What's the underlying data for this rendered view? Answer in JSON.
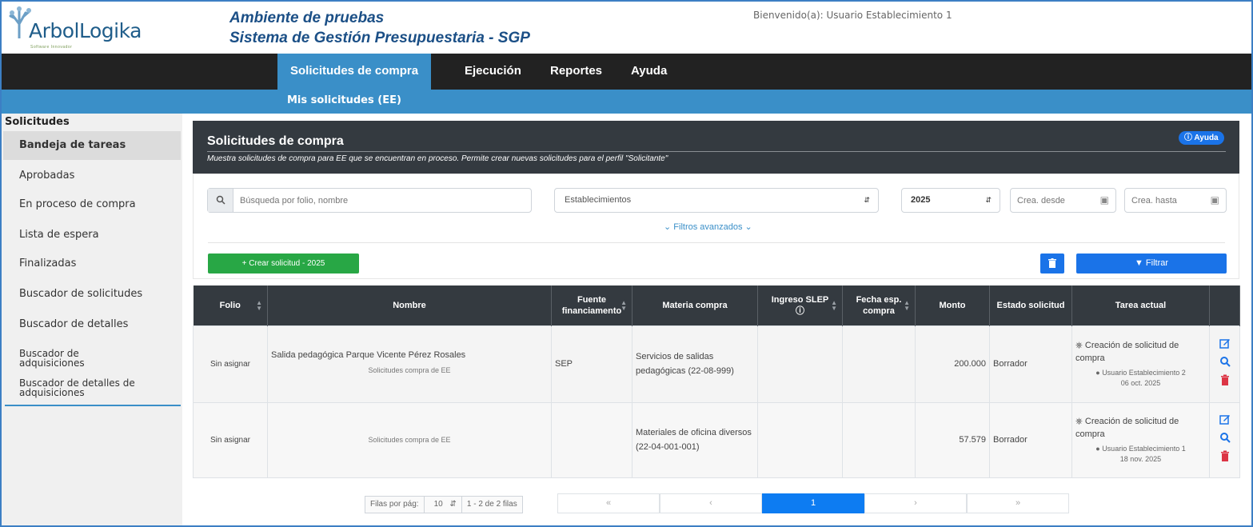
{
  "brand": {
    "name_a": "Arbol",
    "name_b": "Logika",
    "tagline": "Software Innovador"
  },
  "header": {
    "env": "Ambiente de pruebas",
    "system": "Sistema de Gestión Presupuestaria - SGP",
    "welcome": "Bienvenido(a): Usuario Establecimiento 1"
  },
  "nav": {
    "items": [
      {
        "label": "Solicitudes de compra"
      },
      {
        "label": "Ejecución"
      },
      {
        "label": "Reportes"
      },
      {
        "label": "Ayuda"
      }
    ],
    "sub_item": "Mis solicitudes (EE)"
  },
  "sidebar": {
    "title": "Solicitudes",
    "items": [
      {
        "label": "Bandeja de tareas"
      },
      {
        "label": "Aprobadas"
      },
      {
        "label": "En proceso de compra"
      },
      {
        "label": "Lista de espera"
      },
      {
        "label": "Finalizadas"
      },
      {
        "label": "Buscador de solicitudes"
      },
      {
        "label": "Buscador de detalles"
      },
      {
        "label": "Buscador de adquisiciones"
      },
      {
        "label": "Buscador de detalles de adquisiciones"
      }
    ]
  },
  "panel": {
    "title": "Solicitudes de compra",
    "description": "Muestra solicitudes de compra para EE que se encuentran en proceso. Permite crear nuevas solicitudes para el perfil \"Solicitante\"",
    "help_label": "Ayuda"
  },
  "filters": {
    "search_placeholder": "Búsqueda por folio, nombre",
    "establishments": "Establecimientos",
    "year": "2025",
    "from_placeholder": "Crea. desde",
    "to_placeholder": "Crea. hasta",
    "advanced": "Filtros avanzados",
    "create_label": "Crear solicitud - 2025",
    "filter_label": "Filtrar"
  },
  "table": {
    "headers": [
      "Folio",
      "Nombre",
      "Fuente financiamento",
      "Materia compra",
      "Ingreso SLEP",
      "Fecha esp. compra",
      "Monto",
      "Estado solicitud",
      "Tarea actual",
      ""
    ],
    "rows": [
      {
        "folio": "Sin asignar",
        "nombre": "Salida pedagógica Parque Vicente Pérez Rosales",
        "sub": "Solicitudes compra de EE",
        "fuente": "SEP",
        "materia": "Servicios de salidas pedagógicas (22-08-999)",
        "ingreso": "",
        "fecha": "",
        "monto": "200.000",
        "estado": "Borrador",
        "tarea": "Creación de solicitud de compra",
        "usuario": "Usuario Establecimiento 2",
        "fecha_tarea": "06 oct. 2025"
      },
      {
        "folio": "Sin asignar",
        "nombre": "",
        "sub": "Solicitudes compra de EE",
        "fuente": "",
        "materia": "Materiales de oficina diversos (22-04-001-001)",
        "ingreso": "",
        "fecha": "",
        "monto": "57.579",
        "estado": "Borrador",
        "tarea": "Creación de solicitud de compra",
        "usuario": "Usuario Establecimiento 1",
        "fecha_tarea": "18 nov. 2025"
      }
    ]
  },
  "pagination": {
    "rows_label": "Filas por pág:",
    "rows_value": "10",
    "range": "1 - 2 de 2 filas",
    "pages": [
      "«",
      "‹",
      "1",
      "›",
      "»"
    ]
  },
  "colors": {
    "nav_dark": "#222222",
    "accent_blue": "#3a8fc8",
    "primary": "#1a73e8",
    "success": "#28a745",
    "danger": "#dc3545"
  }
}
